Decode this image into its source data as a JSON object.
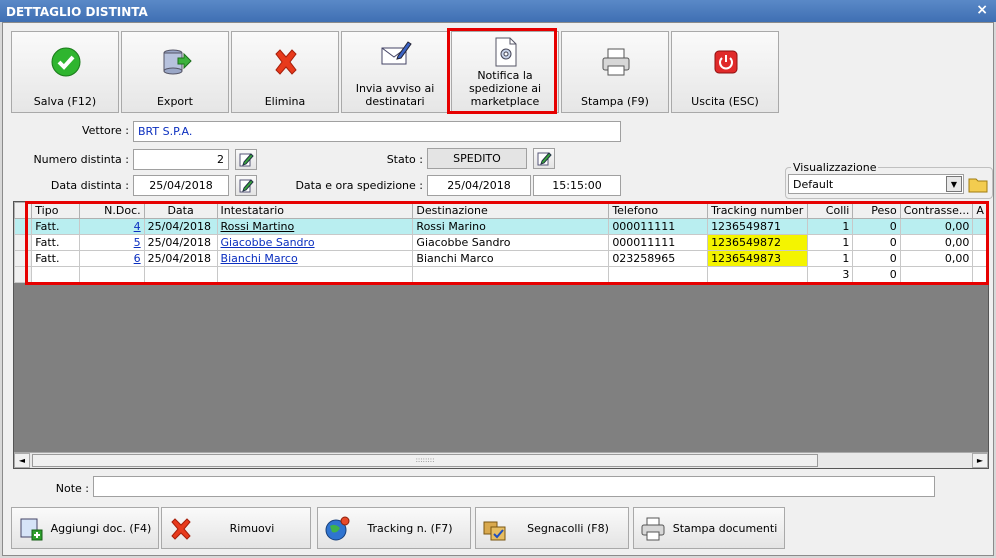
{
  "window": {
    "title": "DETTAGLIO DISTINTA",
    "close": "×"
  },
  "toolbar": {
    "save": "Salva (F12)",
    "export": "Export",
    "delete": "Elimina",
    "notify_recipients": "Invia avviso ai destinatari",
    "notify_marketplace": "Notifica la spedizione ai marketplace",
    "print": "Stampa (F9)",
    "exit": "Uscita (ESC)"
  },
  "form": {
    "vettore_label": "Vettore :",
    "vettore_value": "BRT S.P.A.",
    "numero_label": "Numero distinta :",
    "numero_value": "2",
    "data_label": "Data distinta :",
    "data_value": "25/04/2018",
    "stato_label": "Stato :",
    "stato_value": "SPEDITO",
    "spedizione_label": "Data e ora spedizione :",
    "spedizione_date": "25/04/2018",
    "spedizione_time": "15:15:00"
  },
  "visualizzazione": {
    "label": "Visualizzazione",
    "selected": "Default"
  },
  "grid": {
    "columns": [
      "Tipo",
      "N.Doc.",
      "Data",
      "Intestatario",
      "Destinazione",
      "Telefono",
      "Tracking number",
      "Colli",
      "Peso",
      "Contrasse...",
      "A"
    ],
    "rows": [
      {
        "tipo": "Fatt.",
        "ndoc": "4",
        "data": "25/04/2018",
        "intestatario": "Rossi Martino",
        "destinazione": "Rossi Marino",
        "telefono": "000011111",
        "tracking": "1236549871",
        "colli": "1",
        "peso": "0",
        "contrassegno": "0,00"
      },
      {
        "tipo": "Fatt.",
        "ndoc": "5",
        "data": "25/04/2018",
        "intestatario": "Giacobbe Sandro",
        "destinazione": "Giacobbe Sandro",
        "telefono": "000011111",
        "tracking": "1236549872",
        "colli": "1",
        "peso": "0",
        "contrassegno": "0,00"
      },
      {
        "tipo": "Fatt.",
        "ndoc": "6",
        "data": "25/04/2018",
        "intestatario": "Bianchi Marco",
        "destinazione": "Bianchi Marco",
        "telefono": "023258965",
        "tracking": "1236549873",
        "colli": "1",
        "peso": "0",
        "contrassegno": "0,00"
      }
    ],
    "totals": {
      "colli": "3",
      "peso": "0"
    },
    "scroll_grip": "::::::::"
  },
  "note": {
    "label": "Note :",
    "value": ""
  },
  "bottom": {
    "add": "Aggiungi doc. (F4)",
    "remove": "Rimuovi",
    "tracking": "Tracking n. (F7)",
    "labels": "Segnacolli (F8)",
    "print_docs": "Stampa documenti"
  },
  "colors": {
    "highlight": "#e60000",
    "tracking": "#f4f400",
    "selected_row": "#b9eef0"
  }
}
